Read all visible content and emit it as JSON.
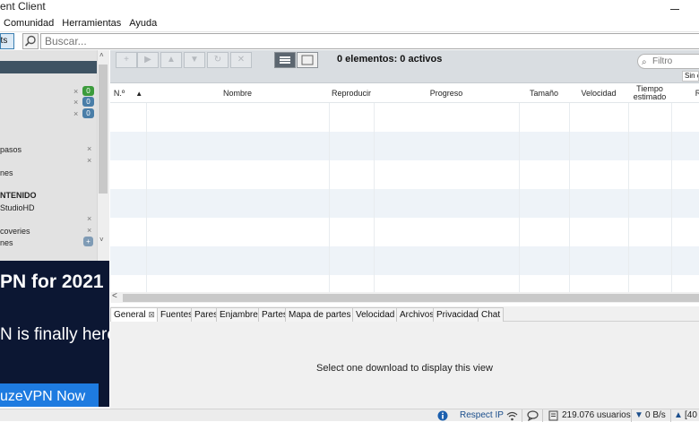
{
  "title": "ent Client",
  "menu": [
    "Comunidad",
    "Herramientas",
    "Ayuda"
  ],
  "search": {
    "tab_label": "nts",
    "placeholder": "Buscar..."
  },
  "sidebar": {
    "items": [
      {
        "label": "",
        "count": "0",
        "color": "#3c9b3c"
      },
      {
        "label": "",
        "count": "0",
        "color": "#4a7ea8"
      },
      {
        "label": "",
        "count": "0",
        "color": "#4a7ea8"
      },
      {
        "label": "pasos"
      },
      {
        "label": ""
      },
      {
        "label": "nes"
      },
      {
        "label": "NTENIDO"
      },
      {
        "label": "StudioHD"
      },
      {
        "label": ""
      },
      {
        "label": "coveries"
      },
      {
        "label": "nes"
      }
    ]
  },
  "ad": {
    "line1": "PN for 2021",
    "line2": "N is finally here!",
    "button": "uzeVPN Now"
  },
  "toolbar": {
    "count_text": "0 elementos: 0 activos",
    "filter_placeholder": "Filtro",
    "sin_label": "Sin c"
  },
  "table": {
    "columns": [
      "N.º",
      "Nombre",
      "Reproducir",
      "Progreso",
      "Tamaño",
      "Velocidad",
      "Tiempo estimado",
      "R"
    ],
    "sort_indicator": "▲"
  },
  "bottom_tabs": [
    "General",
    "Fuentes",
    "Pares",
    "Enjambre",
    "Partes",
    "Mapa de partes",
    "Velocidad",
    "Archivos",
    "Privacidad",
    "Chat"
  ],
  "detail_message": "Select one download to display this view",
  "status": {
    "ip": "Respect IP",
    "users": "219.076 usuarios",
    "down": "0 B/s",
    "up": "[40"
  }
}
